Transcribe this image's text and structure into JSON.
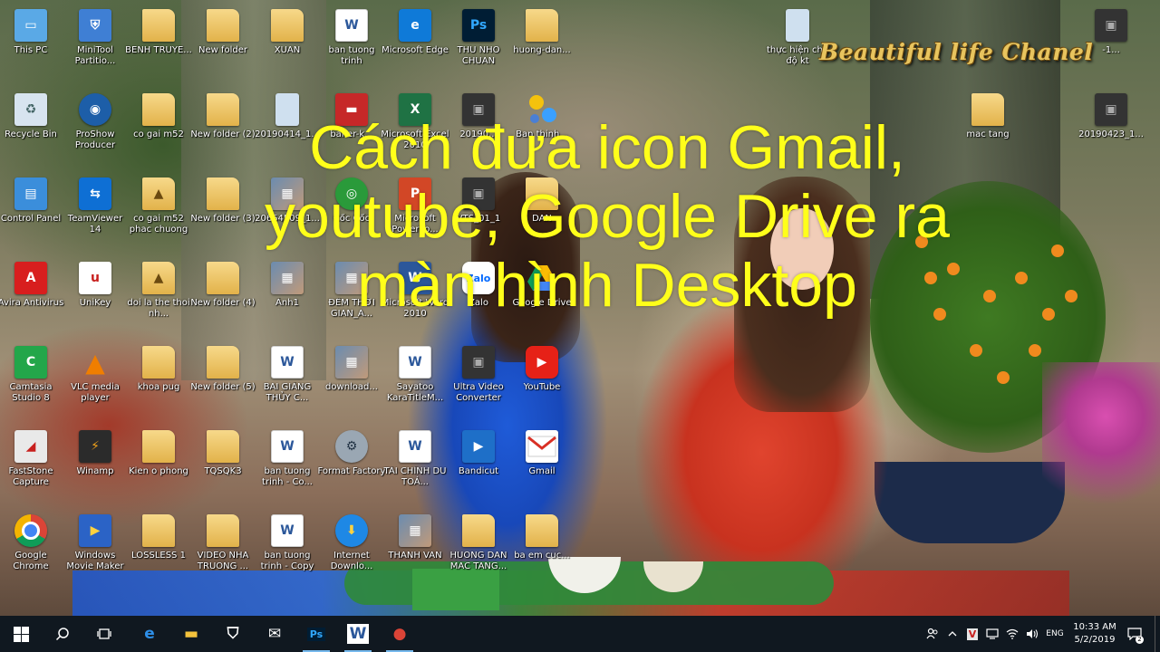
{
  "overlay": {
    "title_line1": "Cách đưa icon Gmail,",
    "title_line2": "youtube, Google Drive ra",
    "title_line3": "màn hình Desktop",
    "channel_logo": "Beautiful life Chanel"
  },
  "desktop": {
    "columns": [
      [
        {
          "id": "this-pc",
          "label": "This PC",
          "icon": "computer-icon"
        },
        {
          "id": "recycle-bin",
          "label": "Recycle Bin",
          "icon": "recycle-bin-icon"
        },
        {
          "id": "control-panel",
          "label": "Control Panel",
          "icon": "control-panel-icon"
        },
        {
          "id": "avira",
          "label": "Avira Antivirus",
          "icon": "avira-icon"
        },
        {
          "id": "camtasia",
          "label": "Camtasia Studio 8",
          "icon": "camtasia-icon"
        },
        {
          "id": "faststone",
          "label": "FastStone Capture",
          "icon": "faststone-icon"
        },
        {
          "id": "google-chrome",
          "label": "Google Chrome",
          "icon": "chrome-icon"
        }
      ],
      [
        {
          "id": "minitool",
          "label": "MiniTool Partitio...",
          "icon": "minitool-icon"
        },
        {
          "id": "proshow",
          "label": "ProShow Producer",
          "icon": "proshow-icon"
        },
        {
          "id": "teamviewer",
          "label": "TeamViewer 14",
          "icon": "teamviewer-icon"
        },
        {
          "id": "unikey",
          "label": "UniKey",
          "icon": "unikey-icon"
        },
        {
          "id": "vlc",
          "label": "VLC media player",
          "icon": "vlc-icon"
        },
        {
          "id": "winamp",
          "label": "Winamp",
          "icon": "winamp-icon"
        },
        {
          "id": "windows-movie-maker",
          "label": "Windows Movie Maker",
          "icon": "movie-maker-icon"
        }
      ],
      [
        {
          "id": "benh-truye",
          "label": "BENH TRUYE...",
          "icon": "folder-icon"
        },
        {
          "id": "co-gai-m52",
          "label": "co gai m52",
          "icon": "folder-icon"
        },
        {
          "id": "co-gai-m52-phac",
          "label": "co gai m52 phac chuong",
          "icon": "vlc-file-icon"
        },
        {
          "id": "doi-la-the",
          "label": "doi la the thoi nh...",
          "icon": "vlc-file-icon"
        },
        {
          "id": "khoa-pug",
          "label": "khoa pug",
          "icon": "folder-icon"
        },
        {
          "id": "kien-o-phong",
          "label": "Kien o phong",
          "icon": "folder-icon"
        },
        {
          "id": "lossless",
          "label": "LOSSLESS 1",
          "icon": "folder-icon"
        }
      ],
      [
        {
          "id": "new-folder",
          "label": "New folder",
          "icon": "folder-icon"
        },
        {
          "id": "new-folder-2",
          "label": "New folder (2)",
          "icon": "folder-icon"
        },
        {
          "id": "new-folder-3",
          "label": "New folder (3)",
          "icon": "folder-icon"
        },
        {
          "id": "new-folder-4",
          "label": "New folder (4)",
          "icon": "folder-icon"
        },
        {
          "id": "new-folder-5",
          "label": "New folder (5)",
          "icon": "folder-icon"
        },
        {
          "id": "tqsqk3",
          "label": "TQSQK3",
          "icon": "folder-icon"
        },
        {
          "id": "video-nha-truong",
          "label": "VIDEO NHA TRUONG ...",
          "icon": "folder-icon"
        }
      ],
      [
        {
          "id": "xuan",
          "label": "XUAN",
          "icon": "folder-icon"
        },
        {
          "id": "file-20190414",
          "label": "20190414_1...",
          "icon": "thin-file-icon"
        },
        {
          "id": "file-20664509",
          "label": "20664509_1...",
          "icon": "image-icon"
        },
        {
          "id": "anh1",
          "label": "Ảnh1",
          "icon": "image-icon"
        },
        {
          "id": "bai-giang",
          "label": "BAI GIẢNG THỦY C...",
          "icon": "word-doc-icon"
        },
        {
          "id": "ban-tuong-trinh-co",
          "label": "ban tuong trinh - Co...",
          "icon": "word-doc-icon"
        },
        {
          "id": "ban-tuong-trinh-copy",
          "label": "ban tuong trinh - Copy",
          "icon": "word-doc-icon"
        }
      ],
      [
        {
          "id": "ban-tuong-trinh",
          "label": "ban tuong trinh",
          "icon": "word-doc-icon"
        },
        {
          "id": "baner-k",
          "label": "baner-k...",
          "icon": "banner-icon"
        },
        {
          "id": "coc-coc",
          "label": "Cốc Cốc",
          "icon": "coccoc-icon"
        },
        {
          "id": "dem-thoi-gian",
          "label": "ĐẾM THỜI GIAN_A...",
          "icon": "image-icon"
        },
        {
          "id": "download",
          "label": "download...",
          "icon": "image-icon"
        },
        {
          "id": "format-factory",
          "label": "Format Factory",
          "icon": "format-factory-icon"
        },
        {
          "id": "internet-download",
          "label": "Internet Downlo...",
          "icon": "idm-icon"
        }
      ],
      [
        {
          "id": "microsoft-edge",
          "label": "Microsoft Edge",
          "icon": "edge-icon"
        },
        {
          "id": "microsoft-excel",
          "label": "Microsoft Excel 2010",
          "icon": "excel-icon"
        },
        {
          "id": "microsoft-powerpoint",
          "label": "Microsoft PowerPo...",
          "icon": "powerpoint-icon"
        },
        {
          "id": "microsoft-word",
          "label": "Microsoft Word 2010",
          "icon": "word-icon"
        },
        {
          "id": "sayatoo",
          "label": "Sayatoo KaraTitleM...",
          "icon": "word-doc-icon"
        },
        {
          "id": "tai-chinh",
          "label": "TÀI CHÍNH DU TOÁ...",
          "icon": "word-doc-icon"
        },
        {
          "id": "thanh-van",
          "label": "THANH VAN",
          "icon": "image-icon"
        }
      ],
      [
        {
          "id": "thu-nho-chuan",
          "label": "THU NHO CHUAN",
          "icon": "photoshop-icon"
        },
        {
          "id": "file-2019",
          "label": "20190...",
          "icon": "film-icon"
        },
        {
          "id": "vts-01",
          "label": "VTS_01_1",
          "icon": "film-icon"
        },
        {
          "id": "zalo",
          "label": "Zalo",
          "icon": "zalo-icon"
        },
        {
          "id": "ultra-video",
          "label": "Ultra Video Converter",
          "icon": "film-icon"
        },
        {
          "id": "bandicut",
          "label": "Bandicut",
          "icon": "bandicut-icon"
        },
        {
          "id": "huong-dan-mac-tang",
          "label": "HUONG DAN MAC TANG...",
          "icon": "folder-icon"
        }
      ],
      [
        {
          "id": "huong-dan",
          "label": "huong-dan...",
          "icon": "folder-icon"
        },
        {
          "id": "ban-thinh",
          "label": "Ban thinh...",
          "icon": "spheres-icon"
        },
        {
          "id": "dan",
          "label": "DAN",
          "icon": "folder-icon"
        },
        {
          "id": "google-drive",
          "label": "Google Drive",
          "icon": "google-drive-icon"
        },
        {
          "id": "youtube",
          "label": "YouTube",
          "icon": "youtube-icon"
        },
        {
          "id": "gmail",
          "label": "Gmail",
          "icon": "gmail-icon"
        },
        {
          "id": "ba-em-cuc",
          "label": "ba em cuc...",
          "icon": "folder-icon"
        }
      ]
    ],
    "right_icons": [
      {
        "id": "thuc-hien-che-do",
        "label": "thực hiện chế độ kt",
        "icon": "thin-file-icon"
      },
      {
        "id": "file-tr-1",
        "label": "-1...",
        "icon": "film-icon"
      },
      {
        "id": "mac-tang",
        "label": "mac tang",
        "icon": "folder-icon"
      },
      {
        "id": "file-20190423",
        "label": "20190423_1...",
        "icon": "film-icon"
      }
    ]
  },
  "taskbar": {
    "start_label": "Start",
    "search_label": "Search",
    "taskview_label": "Task View",
    "pinned": [
      {
        "id": "edge",
        "label": "Microsoft Edge",
        "icon": "edge-icon",
        "glyph": "e",
        "color": "#2e8fe8"
      },
      {
        "id": "explorer",
        "label": "File Explorer",
        "icon": "folder-icon",
        "glyph": "▬",
        "color": "#f3c23c"
      },
      {
        "id": "store",
        "label": "Microsoft Store",
        "icon": "store-icon",
        "glyph": "⛉",
        "color": "#ffffff"
      },
      {
        "id": "mail",
        "label": "Mail",
        "icon": "mail-icon",
        "glyph": "✉",
        "color": "#ffffff"
      },
      {
        "id": "photoshop",
        "label": "Photoshop",
        "icon": "photoshop-icon",
        "glyph": "Ps",
        "color": "#31a8ff"
      },
      {
        "id": "word",
        "label": "Word",
        "icon": "word-icon",
        "glyph": "W",
        "color": "#2b579a"
      },
      {
        "id": "chrome",
        "label": "Google Chrome",
        "icon": "chrome-icon",
        "glyph": "●",
        "color": "#db4437"
      }
    ],
    "tray": {
      "language": "ENG",
      "time": "10:33 AM",
      "date": "5/2/2019",
      "notification_count": "2"
    }
  }
}
